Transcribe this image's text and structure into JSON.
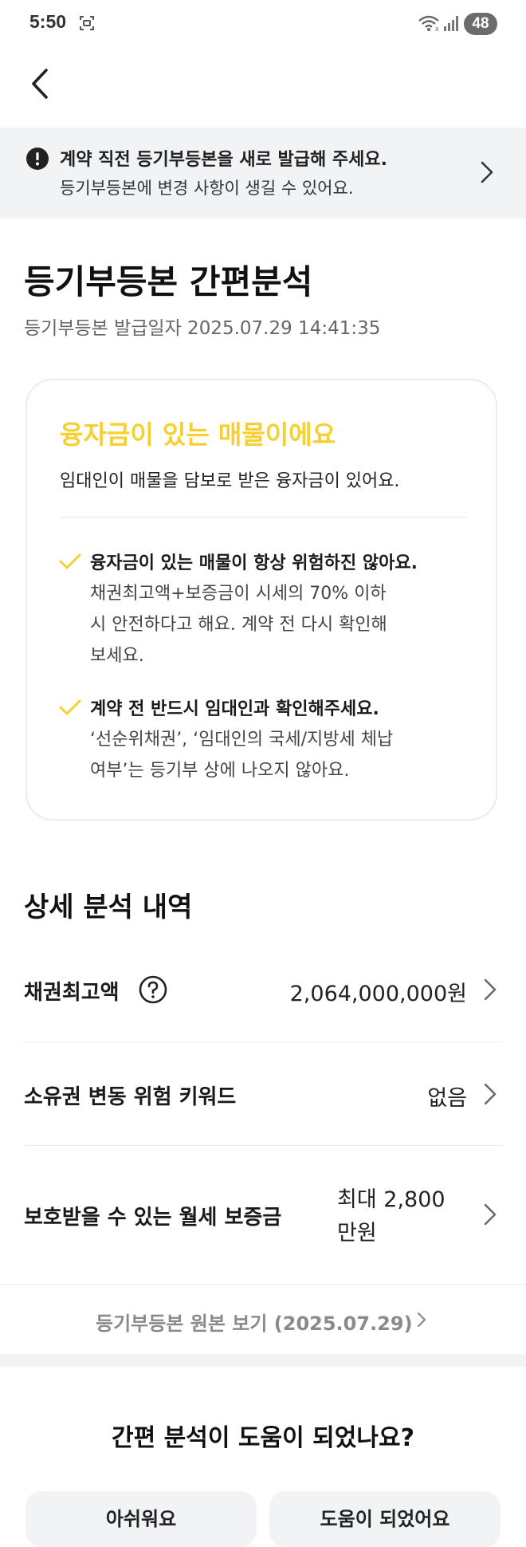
{
  "status_bar": {
    "time": "5:50",
    "battery": "48"
  },
  "notice": {
    "title": "계약 직전 등기부등본을 새로 발급해 주세요.",
    "subtitle": "등기부등본에 변경 사항이 생길 수 있어요."
  },
  "page": {
    "title": "등기부등본 간편분석",
    "issue_date": "등기부등본 발급일자 2025.07.29 14:41:35"
  },
  "summary_card": {
    "headline": "융자금이 있는 매물이에요",
    "headline_color": "#f7cf2e",
    "description": "임대인이 매물을 담보로 받은 융자금이 있어요.",
    "checks": [
      {
        "title": "융자금이 있는 매물이 항상 위험하진 않아요.",
        "lines": [
          "채권최고액+보증금이 시세의 70% 이하",
          "시 안전하다고 해요. 계약 전 다시 확인해",
          "보세요."
        ]
      },
      {
        "title": "계약 전 반드시 임대인과 확인해주세요.",
        "lines": [
          "‘선순위채권’, ‘임대인의 국세/지방세 체납",
          "여부’는 등기부 상에 나오지 않아요."
        ]
      }
    ]
  },
  "details": {
    "section_title": "상세 분석 내역",
    "rows": [
      {
        "label": "채권최고액",
        "value": "2,064,000,000원"
      },
      {
        "label": "소유권 변동 위험 키워드",
        "value": "없음"
      },
      {
        "label": "보호받을 수 있는 월세 보증금",
        "value_line1": "최대 2,800",
        "value_line2": "만원"
      }
    ]
  },
  "original_link": {
    "label": "등기부등본 원본 보기 (2025.07.29)"
  },
  "feedback": {
    "question": "간편 분석이 도움이 되었나요?",
    "negative_label": "아쉬워요",
    "positive_label": "도움이 되었어요"
  }
}
